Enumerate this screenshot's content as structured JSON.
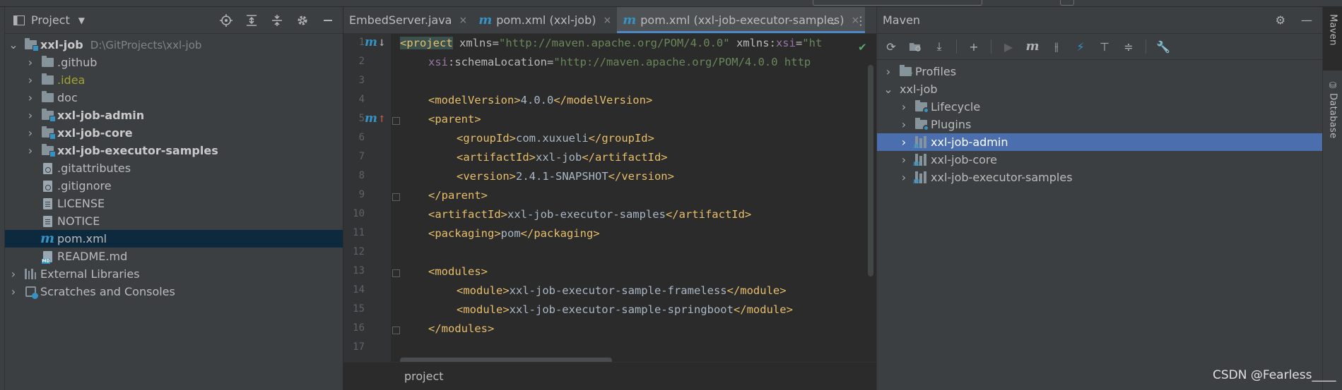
{
  "project_panel": {
    "title": "Project",
    "root": {
      "name": "xxl-job",
      "path": "D:\\GitProjects\\xxl-job"
    },
    "items": [
      {
        "label": ".github",
        "kind": "folder",
        "expandable": true,
        "bold": false
      },
      {
        "label": ".idea",
        "kind": "folder",
        "expandable": true,
        "bold": false,
        "color": "#a5a22f"
      },
      {
        "label": "doc",
        "kind": "folder",
        "expandable": true,
        "bold": false
      },
      {
        "label": "xxl-job-admin",
        "kind": "module-folder",
        "expandable": true,
        "bold": true
      },
      {
        "label": "xxl-job-core",
        "kind": "module-folder",
        "expandable": true,
        "bold": true
      },
      {
        "label": "xxl-job-executor-samples",
        "kind": "module-folder",
        "expandable": true,
        "bold": true
      },
      {
        "label": ".gitattributes",
        "kind": "git-file",
        "expandable": false
      },
      {
        "label": ".gitignore",
        "kind": "git-file",
        "expandable": false
      },
      {
        "label": "LICENSE",
        "kind": "text-file",
        "expandable": false
      },
      {
        "label": "NOTICE",
        "kind": "text-file",
        "expandable": false
      },
      {
        "label": "pom.xml",
        "kind": "maven-file",
        "expandable": false,
        "selected": true
      },
      {
        "label": "README.md",
        "kind": "md-file",
        "expandable": false
      }
    ],
    "external_libraries": "External Libraries",
    "scratches": "Scratches and Consoles"
  },
  "editor": {
    "tabs": [
      {
        "label": "EmbedServer.java",
        "active": false
      },
      {
        "label": "pom.xml (xxl-job)",
        "active": false
      },
      {
        "label": "pom.xml (xxl-job-executor-samples)",
        "active": true
      }
    ],
    "close_glyph": "×",
    "line_numbers": [
      "1",
      "2",
      "3",
      "4",
      "5",
      "6",
      "7",
      "8",
      "9",
      "10",
      "11",
      "12",
      "13",
      "14",
      "15",
      "16",
      "17"
    ],
    "code": {
      "l1_tag": "<project",
      "l1_attr1": " xmlns=",
      "l1_val1": "\"http://maven.apache.org/POM/4.0.0\"",
      "l1_attr2": " xmlns:",
      "l1_ns": "xsi",
      "l1_eq": "=",
      "l1_val2": "\"ht",
      "l2_ns": "xsi",
      "l2_attr": ":schemaLocation=",
      "l2_val": "\"http://maven.apache.org/POM/4.0.0 http",
      "l4_open": "<modelVersion>",
      "l4_text": "4.0.0",
      "l4_close": "</modelVersion>",
      "l5": "<parent>",
      "l6_open": "<groupId>",
      "l6_text": "com.xuxueli",
      "l6_close": "</groupId>",
      "l7_open": "<artifactId>",
      "l7_text": "xxl-job",
      "l7_close": "</artifactId>",
      "l8_open": "<version>",
      "l8_text": "2.4.1-SNAPSHOT",
      "l8_close": "</version>",
      "l9": "</parent>",
      "l10_open": "<artifactId>",
      "l10_text": "xxl-job-executor-samples",
      "l10_close": "</artifactId>",
      "l11_open": "<packaging>",
      "l11_text": "pom",
      "l11_close": "</packaging>",
      "l13": "<modules>",
      "l14_open": "<module>",
      "l14_text": "xxl-job-executor-sample-frameless",
      "l14_close": "</module>",
      "l15_open": "<module>",
      "l15_text": "xxl-job-executor-sample-springboot",
      "l15_close": "</module>",
      "l16": "</modules>"
    },
    "breadcrumb": "project"
  },
  "maven_panel": {
    "title": "Maven",
    "tree": {
      "profiles": "Profiles",
      "root": "xxl-job",
      "lifecycle": "Lifecycle",
      "plugins": "Plugins",
      "modules": [
        {
          "label": "xxl-job-admin",
          "selected": true
        },
        {
          "label": "xxl-job-core",
          "selected": false
        },
        {
          "label": "xxl-job-executor-samples",
          "selected": false
        }
      ]
    }
  },
  "side_tabs": {
    "maven": "Maven",
    "database": "Database"
  },
  "watermark": "CSDN @Fearless____",
  "colors": {
    "selection": "#4b6eaf",
    "accent": "#3592c4",
    "tag": "#e8bf6a",
    "string": "#6a8759"
  }
}
